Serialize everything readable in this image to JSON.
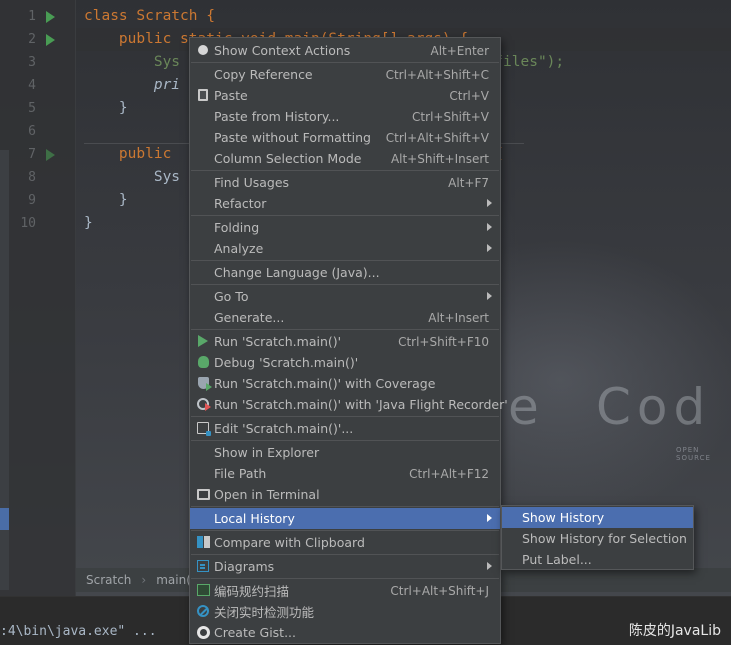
{
  "editor": {
    "line_numbers": [
      "1",
      "2",
      "3",
      "4",
      "5",
      "6",
      "7",
      "8",
      "9",
      "10"
    ],
    "code_lines": [
      "class Scratch {",
      "    public static void main(String[] args) {",
      "        Sys                                  s files\");",
      "        pri",
      "    }",
      "",
      "    public                                  e) {",
      "        Sys",
      "    }",
      "}"
    ],
    "watermark_e": "e",
    "watermark_code": "Cod",
    "watermark_source": "OPEN SOURCE"
  },
  "breadcrumb": {
    "items": [
      "Scratch",
      "main()"
    ]
  },
  "console": {
    "text": ":4\\bin\\java.exe\" ..."
  },
  "brand": "陈皮的JavaLib",
  "menu": {
    "items": [
      {
        "label": "Show Context Actions",
        "shortcut": "Alt+Enter",
        "icon": "bulb-icon"
      },
      {
        "label": "Copy Reference",
        "shortcut": "Ctrl+Alt+Shift+C",
        "icon": ""
      },
      {
        "label": "Paste",
        "shortcut": "Ctrl+V",
        "icon": "clipboard-icon"
      },
      {
        "label": "Paste from History...",
        "shortcut": "Ctrl+Shift+V",
        "icon": ""
      },
      {
        "label": "Paste without Formatting",
        "shortcut": "Ctrl+Alt+Shift+V",
        "icon": ""
      },
      {
        "label": "Column Selection Mode",
        "shortcut": "Alt+Shift+Insert",
        "icon": ""
      },
      {
        "label": "Find Usages",
        "shortcut": "Alt+F7",
        "icon": ""
      },
      {
        "label": "Refactor",
        "shortcut": "",
        "icon": "",
        "submenu": true
      },
      {
        "label": "Folding",
        "shortcut": "",
        "icon": "",
        "submenu": true
      },
      {
        "label": "Analyze",
        "shortcut": "",
        "icon": "",
        "submenu": true
      },
      {
        "label": "Change Language (Java)...",
        "shortcut": "",
        "icon": ""
      },
      {
        "label": "Go To",
        "shortcut": "",
        "icon": "",
        "submenu": true
      },
      {
        "label": "Generate...",
        "shortcut": "Alt+Insert",
        "icon": ""
      },
      {
        "label": "Run 'Scratch.main()'",
        "shortcut": "Ctrl+Shift+F10",
        "icon": "run-icon"
      },
      {
        "label": "Debug 'Scratch.main()'",
        "shortcut": "",
        "icon": "debug-icon"
      },
      {
        "label": "Run 'Scratch.main()' with Coverage",
        "shortcut": "",
        "icon": "coverage-icon"
      },
      {
        "label": "Run 'Scratch.main()' with 'Java Flight Recorder'",
        "shortcut": "",
        "icon": "profiler-icon"
      },
      {
        "label": "Edit 'Scratch.main()'...",
        "shortcut": "",
        "icon": "edit-config-icon"
      },
      {
        "label": "Show in Explorer",
        "shortcut": "",
        "icon": ""
      },
      {
        "label": "File Path",
        "shortcut": "Ctrl+Alt+F12",
        "icon": ""
      },
      {
        "label": "Open in Terminal",
        "shortcut": "",
        "icon": "terminal-icon"
      },
      {
        "label": "Local History",
        "shortcut": "",
        "icon": "",
        "submenu": true,
        "selected": true
      },
      {
        "label": "Compare with Clipboard",
        "shortcut": "",
        "icon": "compare-icon"
      },
      {
        "label": "Diagrams",
        "shortcut": "",
        "icon": "diagram-icon",
        "submenu": true
      },
      {
        "label": "编码规约扫描",
        "shortcut": "Ctrl+Alt+Shift+J",
        "icon": "scan-icon"
      },
      {
        "label": "关闭实时检测功能",
        "shortcut": "",
        "icon": "no-entry-icon"
      },
      {
        "label": "Create Gist...",
        "shortcut": "",
        "icon": "github-icon"
      }
    ]
  },
  "submenu": {
    "items": [
      {
        "label": "Show History",
        "selected": true
      },
      {
        "label": "Show History for Selection"
      },
      {
        "label": "Put Label..."
      }
    ]
  },
  "colors": {
    "menu_bg": "#3c3f41",
    "selection": "#4b6eaf",
    "run_green": "#59a869"
  }
}
